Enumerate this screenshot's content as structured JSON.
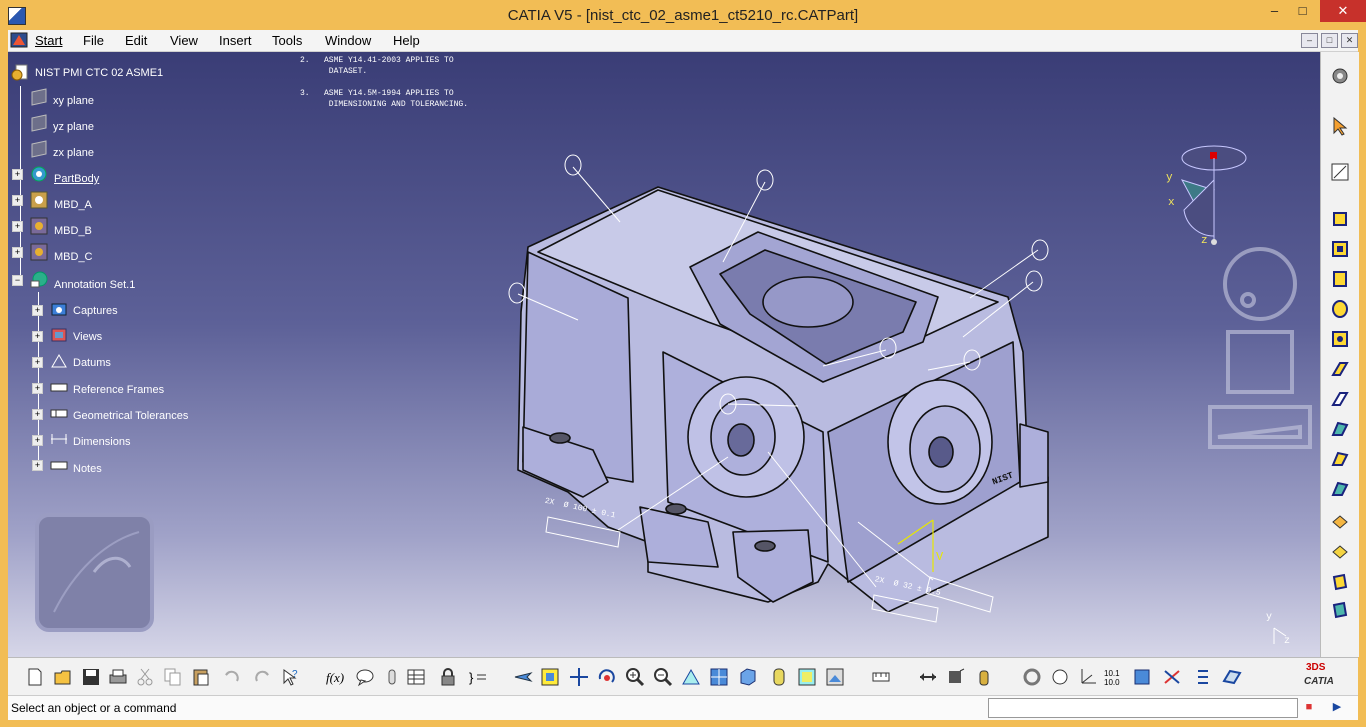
{
  "window": {
    "title": "CATIA V5 - [nist_ctc_02_asme1_ct5210_rc.CATPart]",
    "minimize_glyph": "–",
    "maximize_glyph": "□",
    "close_glyph": "✕"
  },
  "menu": {
    "items": [
      "Start",
      "File",
      "Edit",
      "View",
      "Insert",
      "Tools",
      "Window",
      "Help"
    ]
  },
  "tree": {
    "root": "NIST PMI CTC 02 ASME1",
    "items": [
      {
        "label": "xy plane",
        "icon": "plane-icon"
      },
      {
        "label": "yz plane",
        "icon": "plane-icon"
      },
      {
        "label": "zx plane",
        "icon": "plane-icon"
      },
      {
        "label": "PartBody",
        "icon": "partbody-gear-icon"
      },
      {
        "label": "MBD_A",
        "icon": "geometrical-set-icon"
      },
      {
        "label": "MBD_B",
        "icon": "geometrical-set-icon"
      },
      {
        "label": "MBD_C",
        "icon": "geometrical-set-icon"
      },
      {
        "label": "Annotation Set.1",
        "icon": "annotation-set-icon"
      }
    ],
    "annotation_children": [
      {
        "label": "Captures",
        "icon": "capture-icon"
      },
      {
        "label": "Views",
        "icon": "views-icon"
      },
      {
        "label": "Datums",
        "icon": "datums-icon"
      },
      {
        "label": "Reference Frames",
        "icon": "reference-frames-icon"
      },
      {
        "label": "Geometrical Tolerances",
        "icon": "geometrical-tolerance-icon"
      },
      {
        "label": "Dimensions",
        "icon": "dimensions-icon"
      },
      {
        "label": "Notes",
        "icon": "notes-icon"
      }
    ]
  },
  "notes_text": {
    "line1": "2.   ASME Y14.41-2003 APPLIES TO",
    "line2": "      DATASET.",
    "line3": "3.   ASME Y14.5M-1994 APPLIES TO",
    "line4": "      DIMENSIONING AND TOLERANCING."
  },
  "model_annotations": {
    "dim1": "2X  Ø 100 ± 0.1",
    "dim2": "2X  Ø 32 ± 0.5",
    "logo": "NIST",
    "axis_y": "y",
    "axis_x": "x",
    "axis_z": "z",
    "axis_v": "V",
    "mini_y": "y",
    "mini_z": "z"
  },
  "statusbar": {
    "message": "Select an object or a command",
    "cmd_value": ""
  },
  "brand": {
    "name": "CATIA",
    "ds": "3DS"
  },
  "colors": {
    "titlebar": "#f2bd55",
    "close_button": "#c7312b",
    "viewport_top": "#3a3d76",
    "viewport_bottom": "#d6d6e8",
    "part_fill": "#b9bbe0"
  }
}
